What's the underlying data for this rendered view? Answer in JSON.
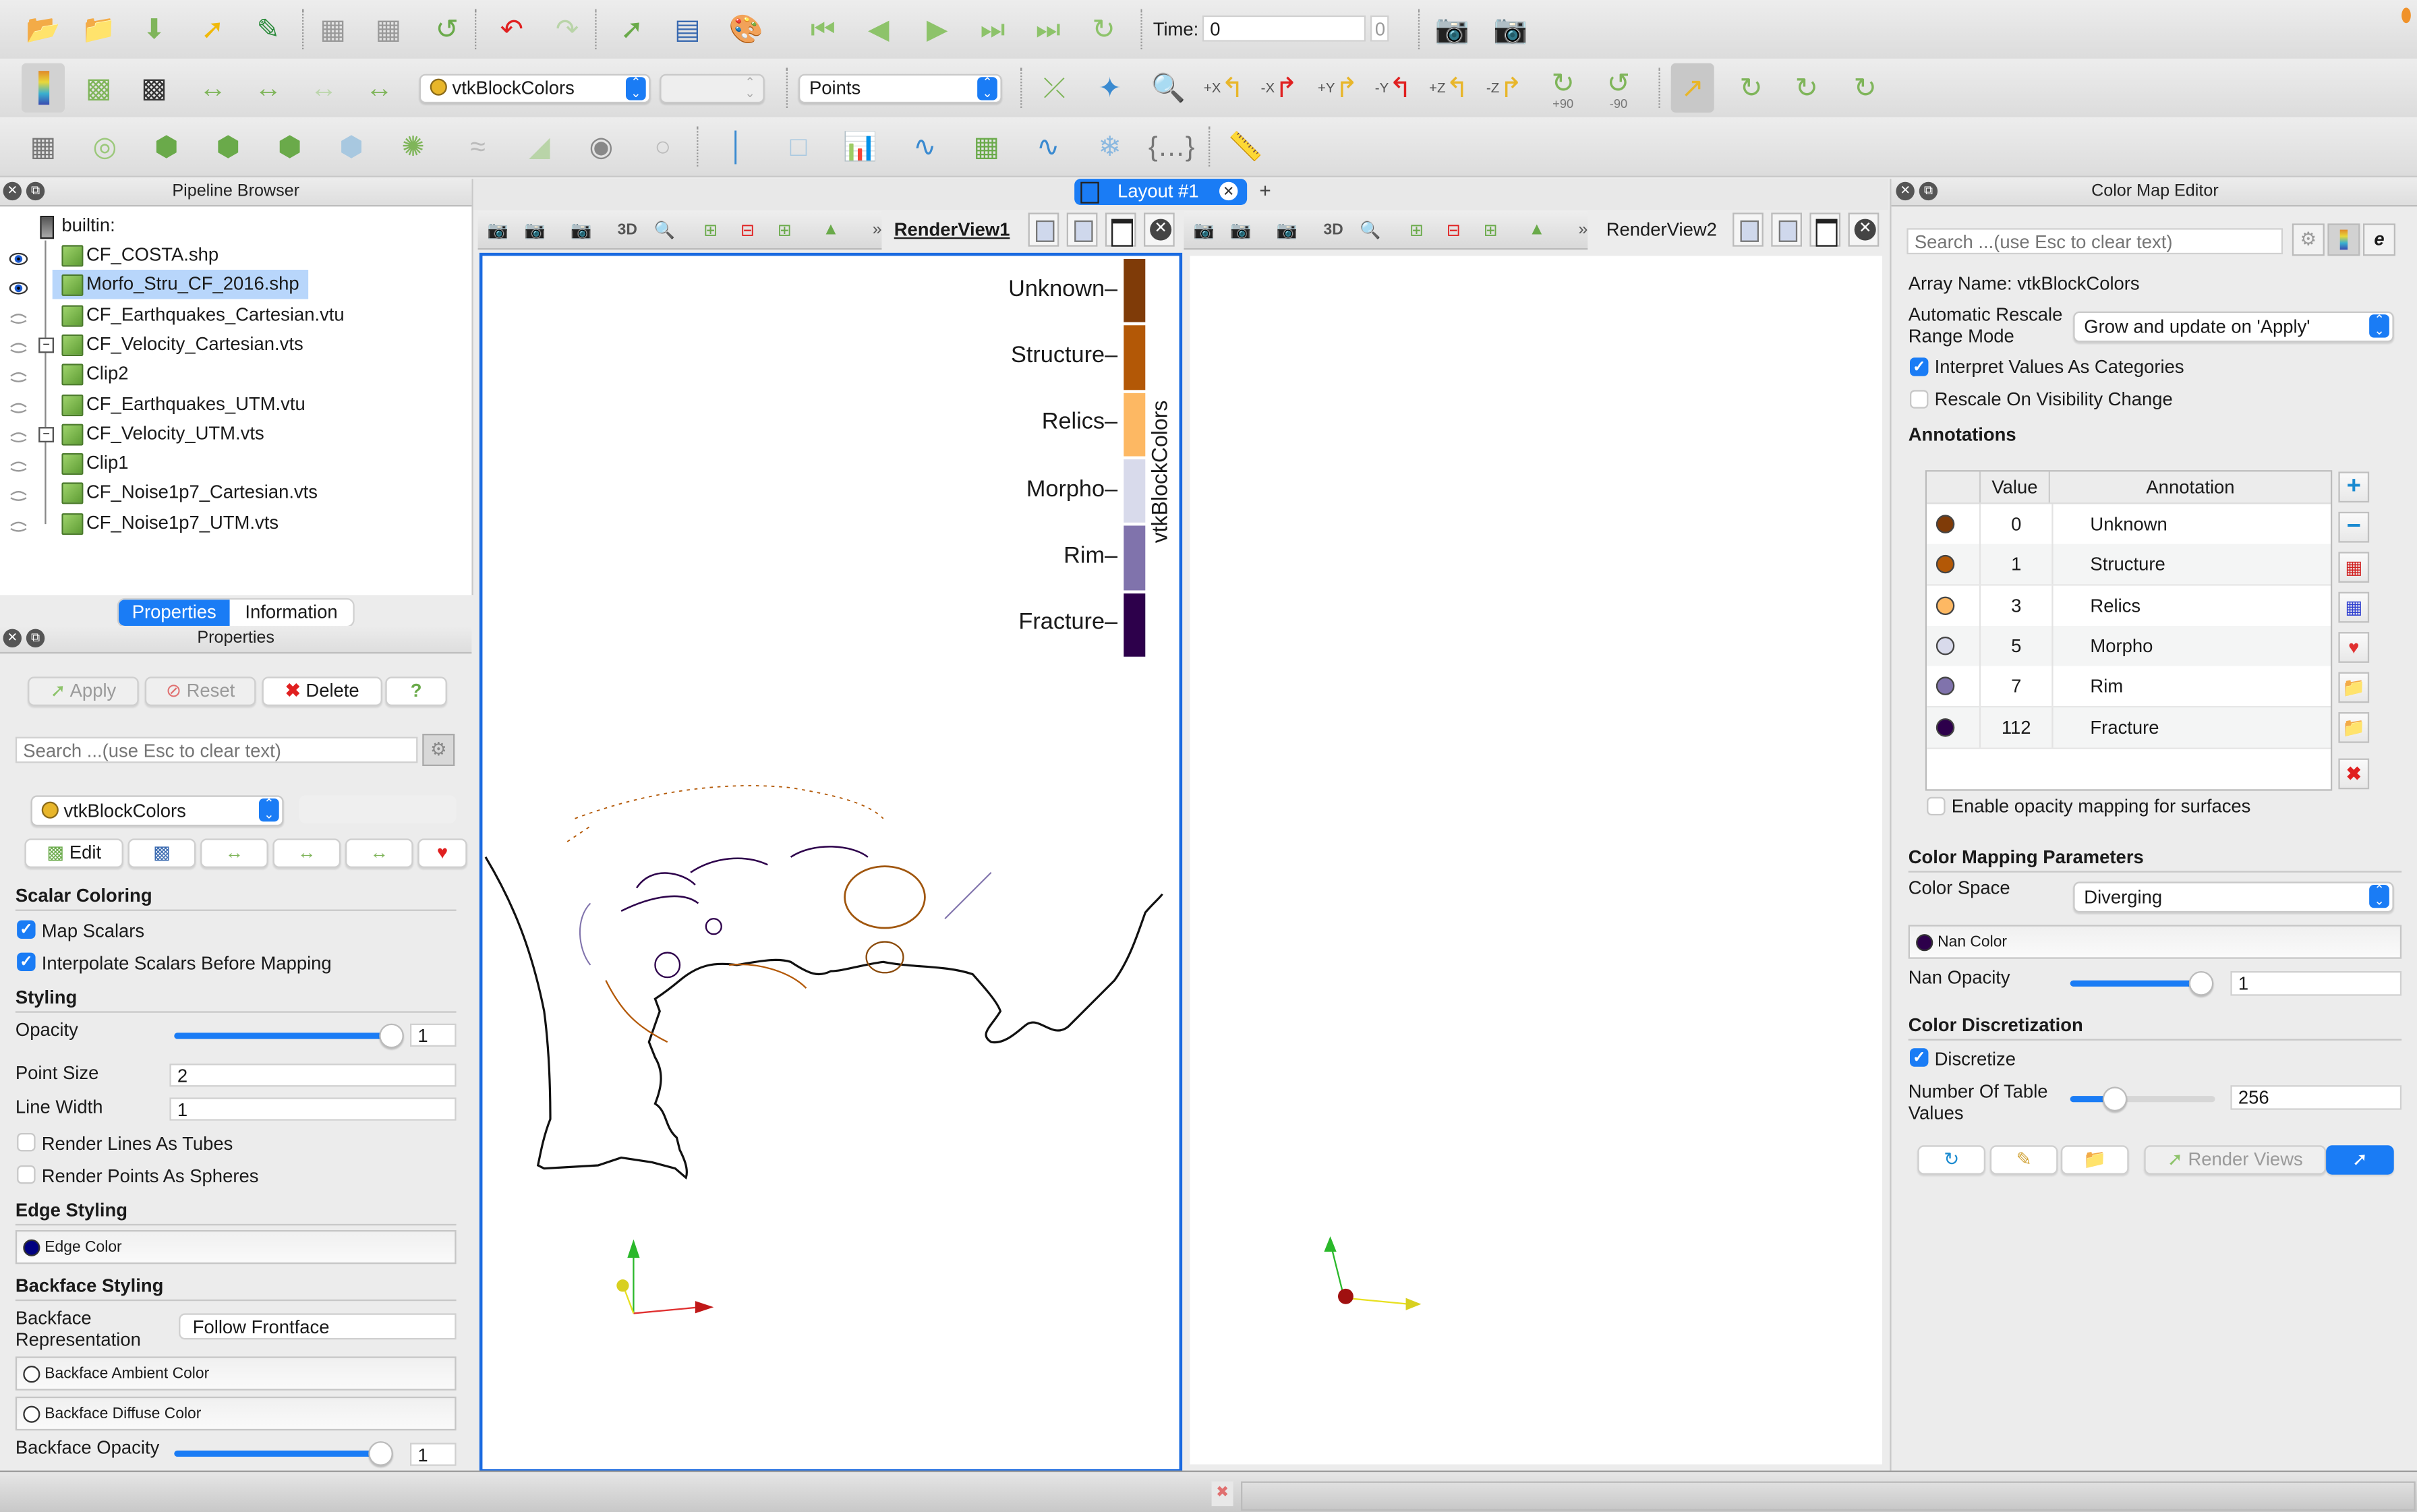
{
  "toolbar": {
    "row1_icons": [
      "open-file-icon",
      "save-data-icon",
      "save-state-icon",
      "connect-icon",
      "paraview-logo-icon",
      "find-data-icon",
      "clear-selection-icon",
      "reset-session-icon",
      "undo-icon",
      "redo-icon",
      "apply-icon",
      "color-legend-icon",
      "palette-icon",
      "first-frame-icon",
      "previous-frame-icon",
      "play-icon",
      "next-frame-icon",
      "last-frame-icon",
      "loop-icon",
      "screenshot-icon",
      "screenshot-add-icon"
    ],
    "time_label": "Time:",
    "time_value": "0",
    "time_index": "0",
    "color_array": "vtkBlockColors",
    "color_component": "",
    "representation": "Points",
    "camera_labels": [
      "+X",
      "-X",
      "+Y",
      "-Y",
      "+Z",
      "-Z",
      "+90",
      "-90"
    ]
  },
  "pipeline_browser": {
    "title": "Pipeline Browser",
    "root": "builtin:",
    "items": [
      {
        "label": "CF_COSTA.shp",
        "visible": true,
        "selected": false,
        "expander": false,
        "indent": 0
      },
      {
        "label": "Morfo_Stru_CF_2016.shp",
        "visible": true,
        "selected": true,
        "expander": false,
        "indent": 0
      },
      {
        "label": "CF_Earthquakes_Cartesian.vtu",
        "visible": false,
        "selected": false,
        "expander": false,
        "indent": 0
      },
      {
        "label": "CF_Velocity_Cartesian.vts",
        "visible": false,
        "selected": false,
        "expander": true,
        "indent": 0
      },
      {
        "label": "Clip2",
        "visible": false,
        "selected": false,
        "expander": false,
        "indent": 1
      },
      {
        "label": "CF_Earthquakes_UTM.vtu",
        "visible": false,
        "selected": false,
        "expander": false,
        "indent": 0
      },
      {
        "label": "CF_Velocity_UTM.vts",
        "visible": false,
        "selected": false,
        "expander": true,
        "indent": 0
      },
      {
        "label": "Clip1",
        "visible": false,
        "selected": false,
        "expander": false,
        "indent": 1
      },
      {
        "label": "CF_Noise1p7_Cartesian.vts",
        "visible": false,
        "selected": false,
        "expander": false,
        "indent": 0
      },
      {
        "label": "CF_Noise1p7_UTM.vts",
        "visible": false,
        "selected": false,
        "expander": false,
        "indent": 0
      }
    ]
  },
  "properties": {
    "tabs": [
      "Properties",
      "Information"
    ],
    "active_tab": "Properties",
    "title": "Properties",
    "apply": "Apply",
    "reset": "Reset",
    "delete": "Delete",
    "help": "?",
    "search_placeholder": "Search ...(use Esc to clear text)",
    "color_array": "vtkBlockColors",
    "edit": "Edit",
    "scalar_coloring": "Scalar Coloring",
    "map_scalars": "Map Scalars",
    "interpolate_scalars": "Interpolate Scalars Before Mapping",
    "styling": "Styling",
    "opacity_label": "Opacity",
    "opacity_value": "1",
    "opacity_fraction": 1.0,
    "point_size_label": "Point Size",
    "point_size": "2",
    "line_width_label": "Line Width",
    "line_width": "1",
    "render_lines_tubes": "Render Lines As Tubes",
    "render_points_spheres": "Render Points As Spheres",
    "edge_styling": "Edge Styling",
    "edge_color": "Edge Color",
    "edge_color_hex": "#000080",
    "backface_styling": "Backface Styling",
    "backface_rep_label": "Backface\nRepresentation",
    "backface_rep_value": "Follow Frontface",
    "backface_ambient": "Backface Ambient Color",
    "backface_diffuse": "Backface Diffuse Color",
    "backface_opacity_label": "Backface Opacity",
    "backface_opacity_value": "1"
  },
  "layout": {
    "tab_label": "Layout #1",
    "add_tab": "+",
    "views": [
      {
        "name": "RenderView1",
        "active": true,
        "mode": "3D"
      },
      {
        "name": "RenderView2",
        "active": false,
        "mode": "3D"
      }
    ]
  },
  "legend": {
    "title": "vtkBlockColors",
    "entries": [
      {
        "label": "Unknown",
        "color": "#7f3b08"
      },
      {
        "label": "Structure",
        "color": "#b35806"
      },
      {
        "label": "Relics",
        "color": "#fdb863"
      },
      {
        "label": "Morpho",
        "color": "#d8daeb"
      },
      {
        "label": "Rim",
        "color": "#8073ac"
      },
      {
        "label": "Fracture",
        "color": "#2d004b"
      }
    ]
  },
  "color_map_editor": {
    "title": "Color Map Editor",
    "search_placeholder": "Search ...(use Esc to clear text)",
    "array_name": "Array Name: vtkBlockColors",
    "auto_rescale_label": "Automatic Rescale\nRange Mode",
    "auto_rescale_value": "Grow and update on 'Apply'",
    "interpret_categories": "Interpret Values As Categories",
    "rescale_visibility": "Rescale On Visibility Change",
    "annotations_title": "Annotations",
    "columns": [
      "",
      "Value",
      "Annotation"
    ],
    "annotations": [
      {
        "value": "0",
        "label": "Unknown",
        "color": "#7f3b08"
      },
      {
        "value": "1",
        "label": "Structure",
        "color": "#b35806"
      },
      {
        "value": "3",
        "label": "Relics",
        "color": "#fdb863"
      },
      {
        "value": "5",
        "label": "Morpho",
        "color": "#d8daeb"
      },
      {
        "value": "7",
        "label": "Rim",
        "color": "#8073ac"
      },
      {
        "value": "112",
        "label": "Fracture",
        "color": "#2d004b"
      }
    ],
    "enable_opacity": "Enable opacity mapping for surfaces",
    "mapping_params": "Color Mapping Parameters",
    "color_space_label": "Color Space",
    "color_space_value": "Diverging",
    "nan_color": "Nan Color",
    "nan_color_hex": "#2d004b",
    "nan_opacity_label": "Nan Opacity",
    "nan_opacity_value": "1",
    "nan_opacity_fraction": 1.0,
    "discretization": "Color Discretization",
    "discretize": "Discretize",
    "table_values_label": "Number Of Table\nValues",
    "table_values": "256",
    "table_values_fraction": 0.3,
    "render_views": "Render Views"
  }
}
